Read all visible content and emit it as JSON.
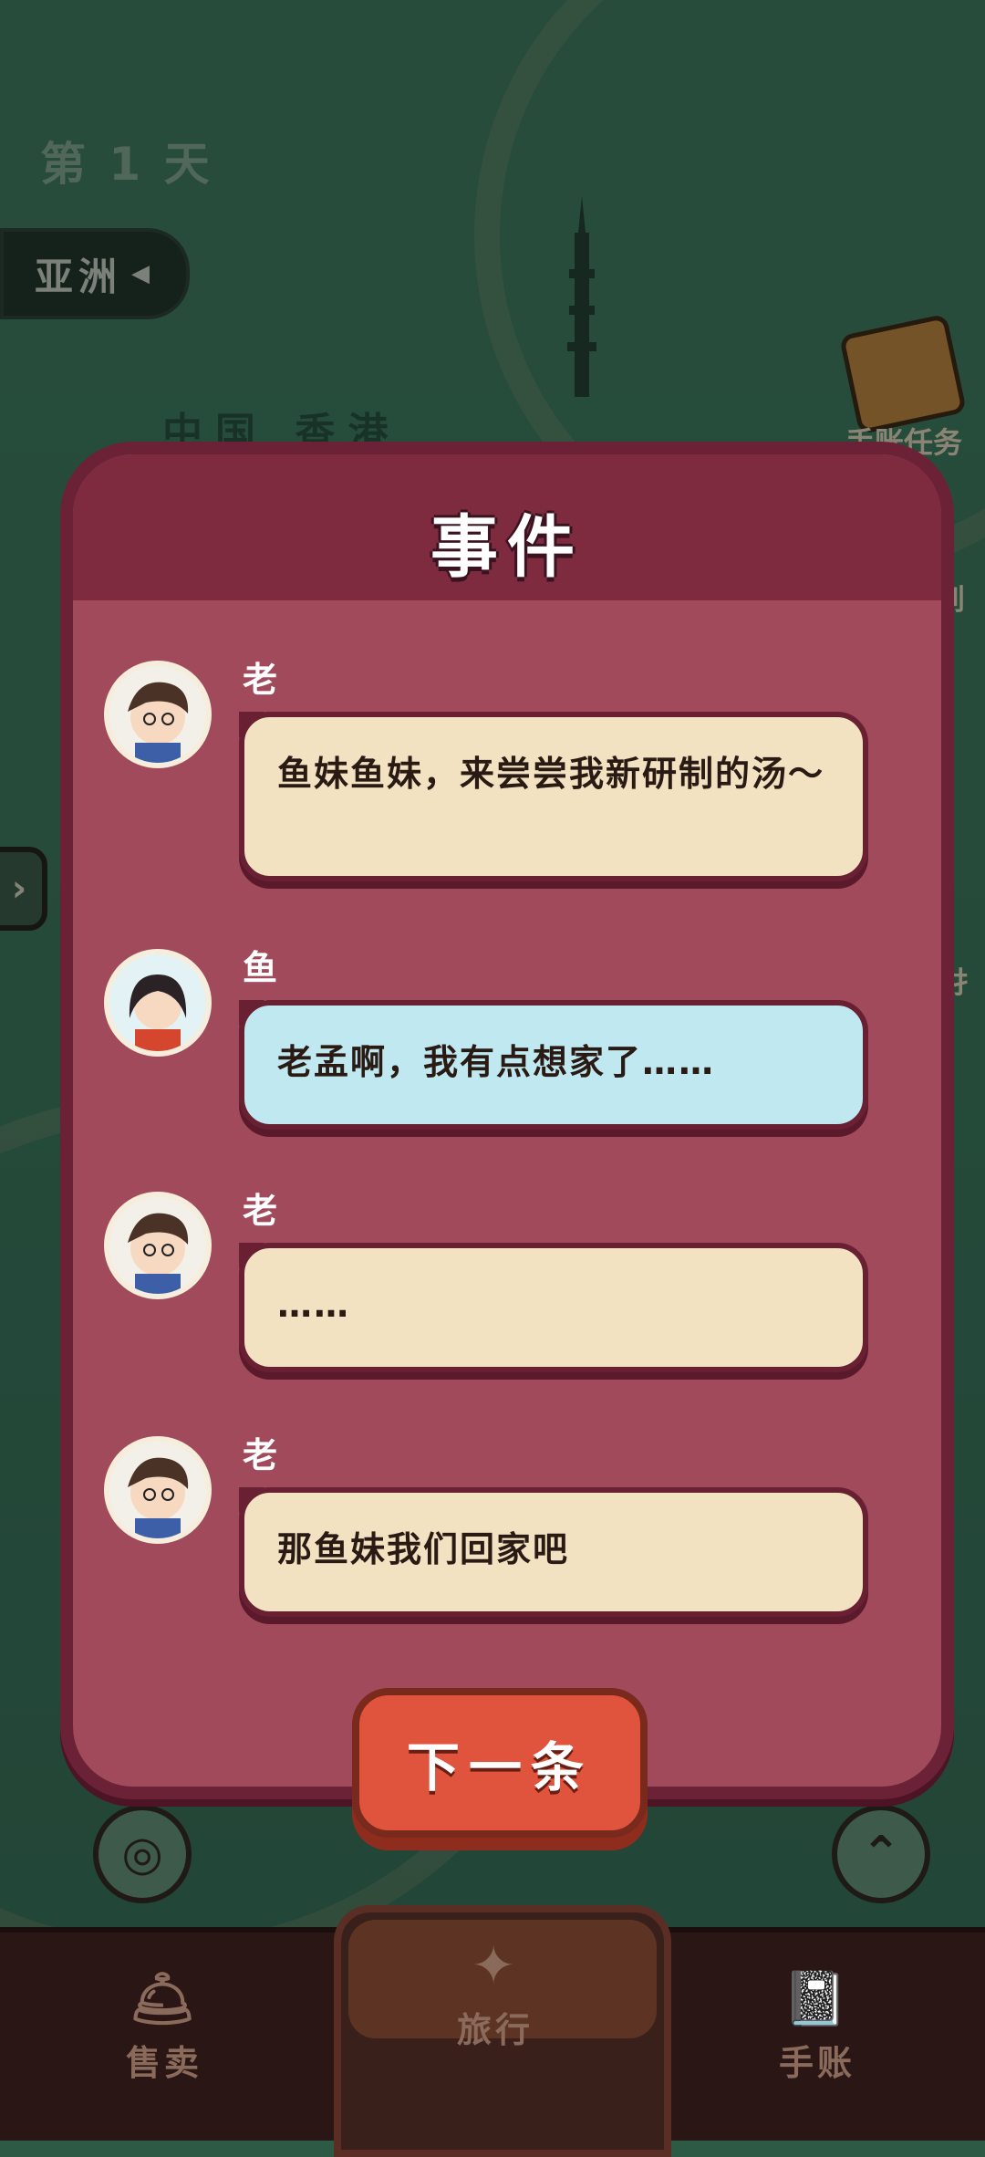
{
  "hud": {
    "day_label": "第 1 天",
    "region": "亚洲",
    "place": "中国 香港",
    "task_label": "手账任务",
    "checkin_label": "到",
    "side_partial": "扌"
  },
  "dialog": {
    "title": "事件",
    "messages": [
      {
        "speaker": "老孟",
        "text": "鱼妹鱼妹，来尝尝我新研制的汤～",
        "style": "cream"
      },
      {
        "speaker": "鱼妹",
        "text": "老孟啊，我有点想家了……",
        "style": "blue"
      },
      {
        "speaker": "老孟",
        "text": "……",
        "style": "cream"
      },
      {
        "speaker": "老孟",
        "text": "那鱼妹我们回家吧",
        "style": "cream"
      }
    ],
    "next_label": "下一条"
  },
  "nav": {
    "tabs": [
      {
        "label": "售卖",
        "icon": "bell-icon"
      },
      {
        "label": "旅行",
        "icon": "traveler-icon"
      },
      {
        "label": "手账",
        "icon": "notebook-icon"
      }
    ]
  },
  "colors": {
    "dialog_bg": "#a04a5c",
    "dialog_border": "#6b2236",
    "bubble_cream": "#f2e2c2",
    "bubble_blue": "#bfe8f0",
    "next_button": "#e0543e"
  }
}
